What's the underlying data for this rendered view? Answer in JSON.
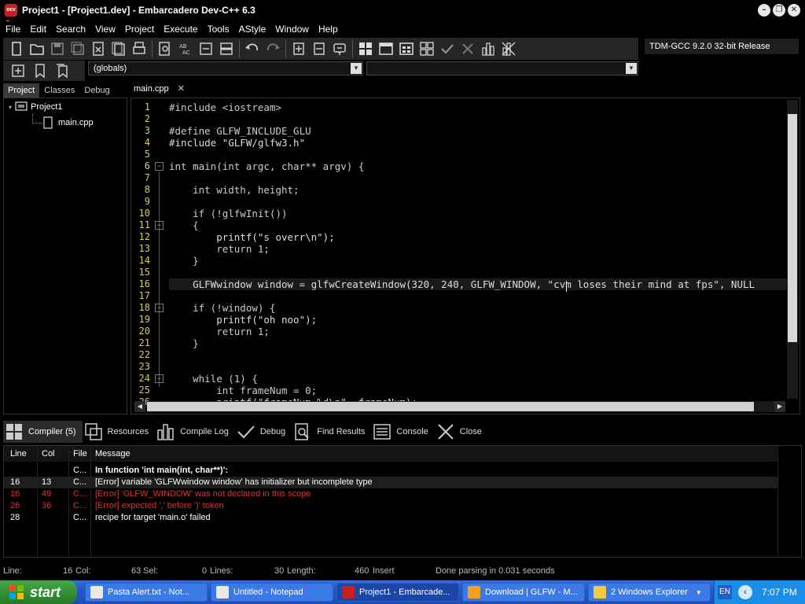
{
  "window": {
    "title": "Project1 - [Project1.dev] - Embarcadero Dev-C++ 6.3",
    "app_icon_text": "DEV C++",
    "minimize": "–",
    "restore": "❐",
    "close": "✕"
  },
  "menu": [
    "File",
    "Edit",
    "Search",
    "View",
    "Project",
    "Execute",
    "Tools",
    "AStyle",
    "Window",
    "Help"
  ],
  "toolbar": {
    "compiler": "TDM-GCC 9.2.0 32-bit Release",
    "globals_combo": "(globals)",
    "second_combo": ""
  },
  "left_panel": {
    "tabs": [
      "Project",
      "Classes",
      "Debug"
    ],
    "tree": {
      "project": "Project1",
      "file": "main.cpp"
    }
  },
  "editor": {
    "tab": "main.cpp",
    "tab_close": "✕",
    "line_numbers": [
      "1",
      "2",
      "3",
      "4",
      "5",
      "6",
      "7",
      "8",
      "9",
      "10",
      "11",
      "12",
      "13",
      "14",
      "15",
      "16",
      "17",
      "18",
      "19",
      "20",
      "21",
      "22",
      "23",
      "24",
      "25",
      "26"
    ],
    "lines": [
      "#include <iostream>",
      "",
      "#define GLFW_INCLUDE_GLU",
      "#include \"GLFW/glfw3.h\"",
      "",
      "int main(int argc, char** argv) {",
      "",
      "    int width, height;",
      "",
      "    if (!glfwInit())",
      "    {",
      "        printf(\"s overr\\n\");",
      "        return 1;",
      "    }",
      "",
      "    GLFWwindow window = glfwCreateWindow(320, 240, GLFW_WINDOW, \"cvm loses their mind at fps\", NULL",
      "",
      "    if (!window) {",
      "        printf(\"oh noo\");",
      "        return 1;",
      "    }",
      "",
      "",
      "    while (1) {",
      "        int frameNum = 0;",
      "        printf(\"frameNum %d\\n\", frameNum);"
    ]
  },
  "bottom_panel": {
    "tabs": [
      "Compiler (5)",
      "Resources",
      "Compile Log",
      "Debug",
      "Find Results",
      "Console",
      "Close"
    ],
    "columns": [
      "Line",
      "Col",
      "File",
      "Message"
    ],
    "rows": [
      {
        "line": "",
        "col": "",
        "file": "C...",
        "message": "In function 'int main(int, char**)':",
        "color": "#ffffff",
        "bold": true
      },
      {
        "line": "16",
        "col": "13",
        "file": "C...",
        "message": "[Error] variable 'GLFWwindow window' has initializer but incomplete type",
        "color": "#ffffff",
        "bold": false
      },
      {
        "line": "16",
        "col": "49",
        "file": "C...",
        "message": "[Error] 'GLFW_WINDOW' was not declared in this scope",
        "color": "#e03030",
        "bold": false
      },
      {
        "line": "26",
        "col": "36",
        "file": "C...",
        "message": "[Error] expected ',' before ')' token",
        "color": "#e03030",
        "bold": false
      },
      {
        "line": "28",
        "col": "",
        "file": "C...",
        "message": "recipe for target 'main.o' failed",
        "color": "#ffffff",
        "bold": false
      }
    ]
  },
  "status": {
    "line_label": "Line:",
    "line_value": "16",
    "col_label": "Col:",
    "col_value": "63",
    "sel_label": "Sel:",
    "sel_value": "0",
    "lines_label": "Lines:",
    "lines_value": "30",
    "length_label": "Length:",
    "length_value": "460",
    "mode": "Insert",
    "message": "Done parsing in 0.031 seconds"
  },
  "taskbar": {
    "start": "start",
    "tasks": [
      {
        "label": "Pasta Alert.txt - Not...",
        "icon_color": "#e8e8e8"
      },
      {
        "label": "Untitled - Notepad",
        "icon_color": "#e8e8e8"
      },
      {
        "label": "Project1 - Embarcade...",
        "icon_color": "#c62020"
      },
      {
        "label": "Download | GLFW - M...",
        "icon_color": "#f4a020"
      },
      {
        "label": "2 Windows Explorer",
        "icon_color": "#f4c840"
      }
    ],
    "language": "EN",
    "clock": "7:07 PM"
  }
}
